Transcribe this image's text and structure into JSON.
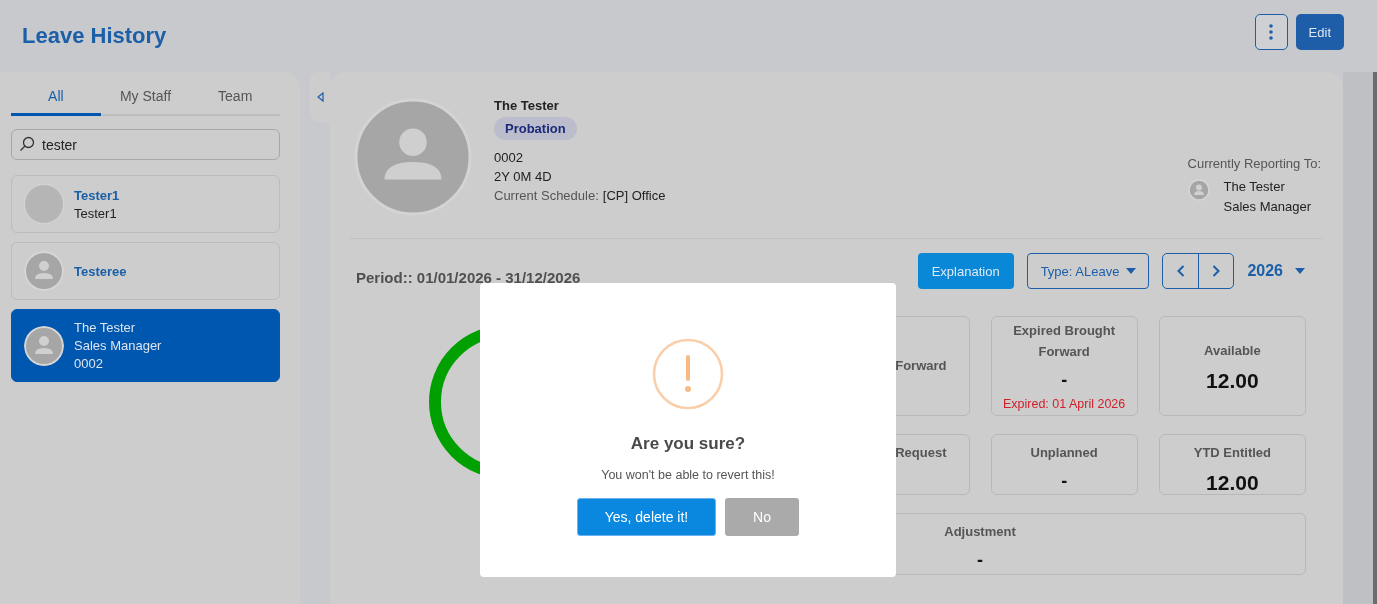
{
  "header": {
    "title": "Leave History",
    "edit_button": "Edit"
  },
  "sidebar": {
    "tabs": [
      {
        "label": "All",
        "selected": true
      },
      {
        "label": "My Staff",
        "selected": false
      },
      {
        "label": "Team",
        "selected": false
      }
    ],
    "search": {
      "value": "tester"
    },
    "people": [
      {
        "name": "Tester1",
        "lines": [
          "Tester1"
        ],
        "kind": "blank",
        "selected": false
      },
      {
        "name": "Testeree",
        "kind": "silhouette",
        "selected": false
      },
      {
        "name": "The Tester",
        "lines": [
          "Sales Manager",
          "0002"
        ],
        "kind": "silhouette",
        "selected": true
      }
    ]
  },
  "profile": {
    "name": "The Tester",
    "badge": "Probation",
    "lines": [
      "0002",
      "2Y 0M 4D"
    ],
    "schedule_label": "Current Schedule:",
    "schedule_value": "[CP] Office",
    "reporting": {
      "label": "Currently Reporting To:",
      "name": "The Tester",
      "title": "Sales Manager"
    }
  },
  "period": "Period:: 01/01/2026 - 31/12/2026",
  "toolbar": {
    "explanation": "Explanation",
    "type": "Type: ALeave",
    "year": "2026"
  },
  "stats": [
    {
      "label": "Forward",
      "wide": false
    },
    {
      "label": "Expired Brought Forward",
      "value": "-",
      "note": "Expired: 01 April 2026",
      "wide": false
    },
    {
      "label": "Available",
      "value": "12.00",
      "wide": false
    },
    {
      "label": "Request",
      "wide": false
    },
    {
      "label": "Unplanned",
      "value": "-",
      "wide": false
    },
    {
      "label": "YTD Entitled",
      "value": "12.00",
      "wide": false
    },
    {
      "label": "Adjustment",
      "value": "-",
      "wide": true
    }
  ],
  "dialog": {
    "title": "Are you sure?",
    "text": "You won't be able to revert this!",
    "confirm": "Yes, delete it!",
    "cancel": "No"
  }
}
